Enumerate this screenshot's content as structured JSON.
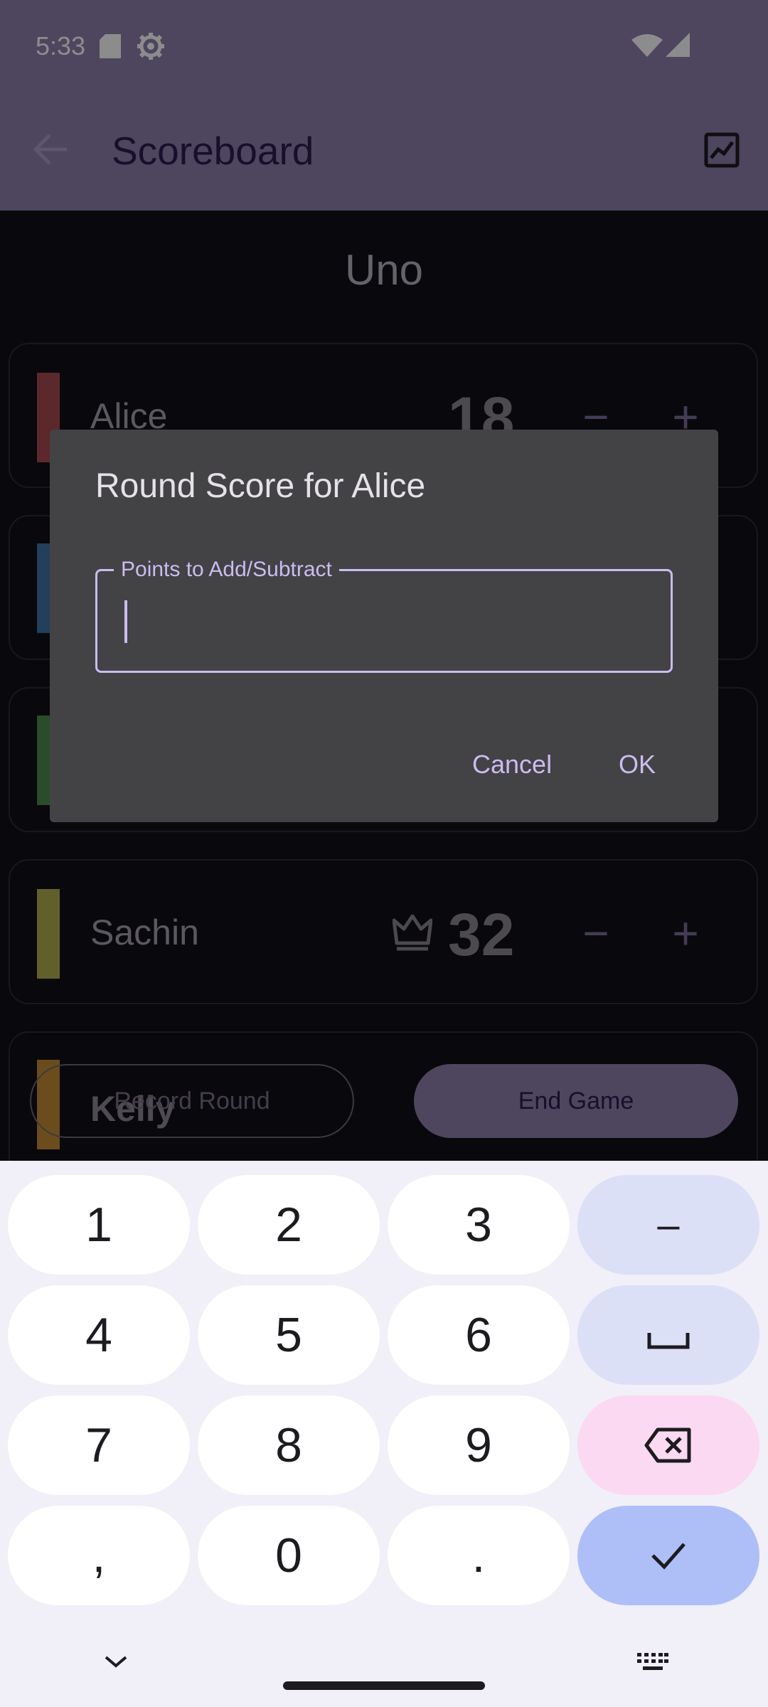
{
  "status_bar": {
    "time": "5:33"
  },
  "app_bar": {
    "title": "Scoreboard"
  },
  "game": {
    "title": "Uno"
  },
  "players": [
    {
      "name": "Alice",
      "score": "18",
      "color": "#a64b4f"
    },
    {
      "name": "",
      "score": "",
      "color": "#3f73a8"
    },
    {
      "name": "",
      "score": "",
      "color": "#4d8a4d"
    },
    {
      "name": "Sachin",
      "score": "32",
      "color": "#b3b04e"
    },
    {
      "name": "Kelly",
      "score": "",
      "color": "#c48b35"
    }
  ],
  "controls": {
    "minus": "−",
    "plus": "+"
  },
  "actions": {
    "record_round": "Record Round",
    "end_game": "End Game"
  },
  "dialog": {
    "title": "Round Score for Alice",
    "field_label": "Points to Add/Subtract",
    "field_value": "",
    "cancel": "Cancel",
    "ok": "OK"
  },
  "keyboard": {
    "rows": [
      [
        "1",
        "2",
        "3",
        "–"
      ],
      [
        "4",
        "5",
        "6",
        "space"
      ],
      [
        "7",
        "8",
        "9",
        "delete"
      ],
      [
        ",",
        "0",
        ".",
        "enter"
      ]
    ]
  },
  "colors": {
    "accent": "#8c80ab",
    "primary_text": "#cbbcf0",
    "surface": "#434245"
  }
}
